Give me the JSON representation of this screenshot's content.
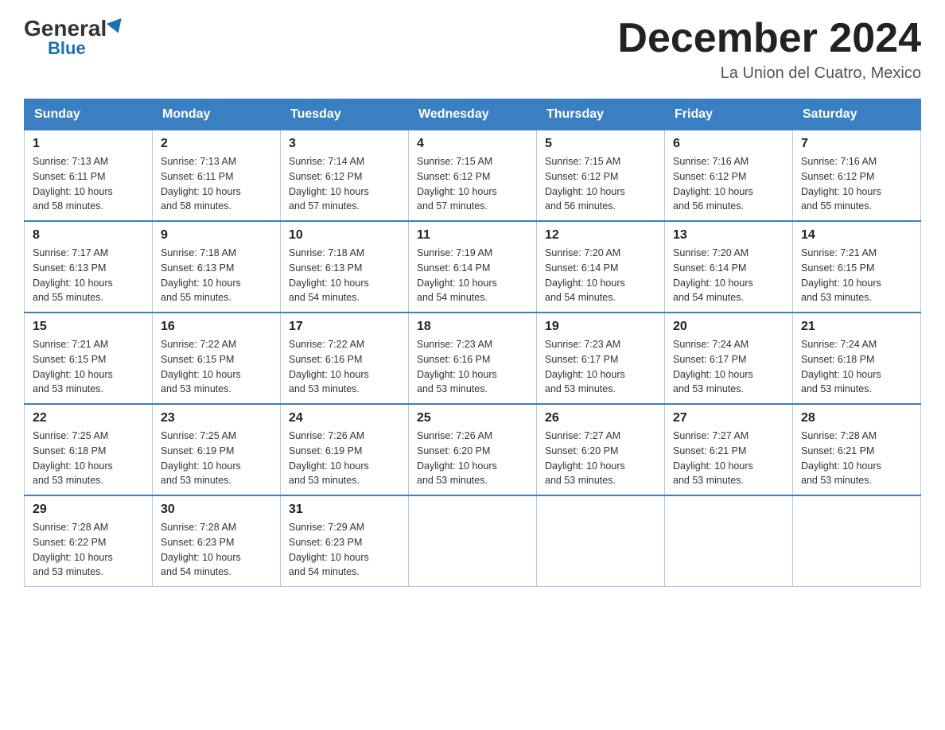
{
  "header": {
    "logo_general": "General",
    "logo_blue": "Blue",
    "month_title": "December 2024",
    "location": "La Union del Cuatro, Mexico"
  },
  "days_of_week": [
    "Sunday",
    "Monday",
    "Tuesday",
    "Wednesday",
    "Thursday",
    "Friday",
    "Saturday"
  ],
  "weeks": [
    [
      {
        "day": "1",
        "sunrise": "7:13 AM",
        "sunset": "6:11 PM",
        "daylight": "10 hours and 58 minutes."
      },
      {
        "day": "2",
        "sunrise": "7:13 AM",
        "sunset": "6:11 PM",
        "daylight": "10 hours and 58 minutes."
      },
      {
        "day": "3",
        "sunrise": "7:14 AM",
        "sunset": "6:12 PM",
        "daylight": "10 hours and 57 minutes."
      },
      {
        "day": "4",
        "sunrise": "7:15 AM",
        "sunset": "6:12 PM",
        "daylight": "10 hours and 57 minutes."
      },
      {
        "day": "5",
        "sunrise": "7:15 AM",
        "sunset": "6:12 PM",
        "daylight": "10 hours and 56 minutes."
      },
      {
        "day": "6",
        "sunrise": "7:16 AM",
        "sunset": "6:12 PM",
        "daylight": "10 hours and 56 minutes."
      },
      {
        "day": "7",
        "sunrise": "7:16 AM",
        "sunset": "6:12 PM",
        "daylight": "10 hours and 55 minutes."
      }
    ],
    [
      {
        "day": "8",
        "sunrise": "7:17 AM",
        "sunset": "6:13 PM",
        "daylight": "10 hours and 55 minutes."
      },
      {
        "day": "9",
        "sunrise": "7:18 AM",
        "sunset": "6:13 PM",
        "daylight": "10 hours and 55 minutes."
      },
      {
        "day": "10",
        "sunrise": "7:18 AM",
        "sunset": "6:13 PM",
        "daylight": "10 hours and 54 minutes."
      },
      {
        "day": "11",
        "sunrise": "7:19 AM",
        "sunset": "6:14 PM",
        "daylight": "10 hours and 54 minutes."
      },
      {
        "day": "12",
        "sunrise": "7:20 AM",
        "sunset": "6:14 PM",
        "daylight": "10 hours and 54 minutes."
      },
      {
        "day": "13",
        "sunrise": "7:20 AM",
        "sunset": "6:14 PM",
        "daylight": "10 hours and 54 minutes."
      },
      {
        "day": "14",
        "sunrise": "7:21 AM",
        "sunset": "6:15 PM",
        "daylight": "10 hours and 53 minutes."
      }
    ],
    [
      {
        "day": "15",
        "sunrise": "7:21 AM",
        "sunset": "6:15 PM",
        "daylight": "10 hours and 53 minutes."
      },
      {
        "day": "16",
        "sunrise": "7:22 AM",
        "sunset": "6:15 PM",
        "daylight": "10 hours and 53 minutes."
      },
      {
        "day": "17",
        "sunrise": "7:22 AM",
        "sunset": "6:16 PM",
        "daylight": "10 hours and 53 minutes."
      },
      {
        "day": "18",
        "sunrise": "7:23 AM",
        "sunset": "6:16 PM",
        "daylight": "10 hours and 53 minutes."
      },
      {
        "day": "19",
        "sunrise": "7:23 AM",
        "sunset": "6:17 PM",
        "daylight": "10 hours and 53 minutes."
      },
      {
        "day": "20",
        "sunrise": "7:24 AM",
        "sunset": "6:17 PM",
        "daylight": "10 hours and 53 minutes."
      },
      {
        "day": "21",
        "sunrise": "7:24 AM",
        "sunset": "6:18 PM",
        "daylight": "10 hours and 53 minutes."
      }
    ],
    [
      {
        "day": "22",
        "sunrise": "7:25 AM",
        "sunset": "6:18 PM",
        "daylight": "10 hours and 53 minutes."
      },
      {
        "day": "23",
        "sunrise": "7:25 AM",
        "sunset": "6:19 PM",
        "daylight": "10 hours and 53 minutes."
      },
      {
        "day": "24",
        "sunrise": "7:26 AM",
        "sunset": "6:19 PM",
        "daylight": "10 hours and 53 minutes."
      },
      {
        "day": "25",
        "sunrise": "7:26 AM",
        "sunset": "6:20 PM",
        "daylight": "10 hours and 53 minutes."
      },
      {
        "day": "26",
        "sunrise": "7:27 AM",
        "sunset": "6:20 PM",
        "daylight": "10 hours and 53 minutes."
      },
      {
        "day": "27",
        "sunrise": "7:27 AM",
        "sunset": "6:21 PM",
        "daylight": "10 hours and 53 minutes."
      },
      {
        "day": "28",
        "sunrise": "7:28 AM",
        "sunset": "6:21 PM",
        "daylight": "10 hours and 53 minutes."
      }
    ],
    [
      {
        "day": "29",
        "sunrise": "7:28 AM",
        "sunset": "6:22 PM",
        "daylight": "10 hours and 53 minutes."
      },
      {
        "day": "30",
        "sunrise": "7:28 AM",
        "sunset": "6:23 PM",
        "daylight": "10 hours and 54 minutes."
      },
      {
        "day": "31",
        "sunrise": "7:29 AM",
        "sunset": "6:23 PM",
        "daylight": "10 hours and 54 minutes."
      },
      null,
      null,
      null,
      null
    ]
  ],
  "labels": {
    "sunrise": "Sunrise:",
    "sunset": "Sunset:",
    "daylight": "Daylight:"
  }
}
